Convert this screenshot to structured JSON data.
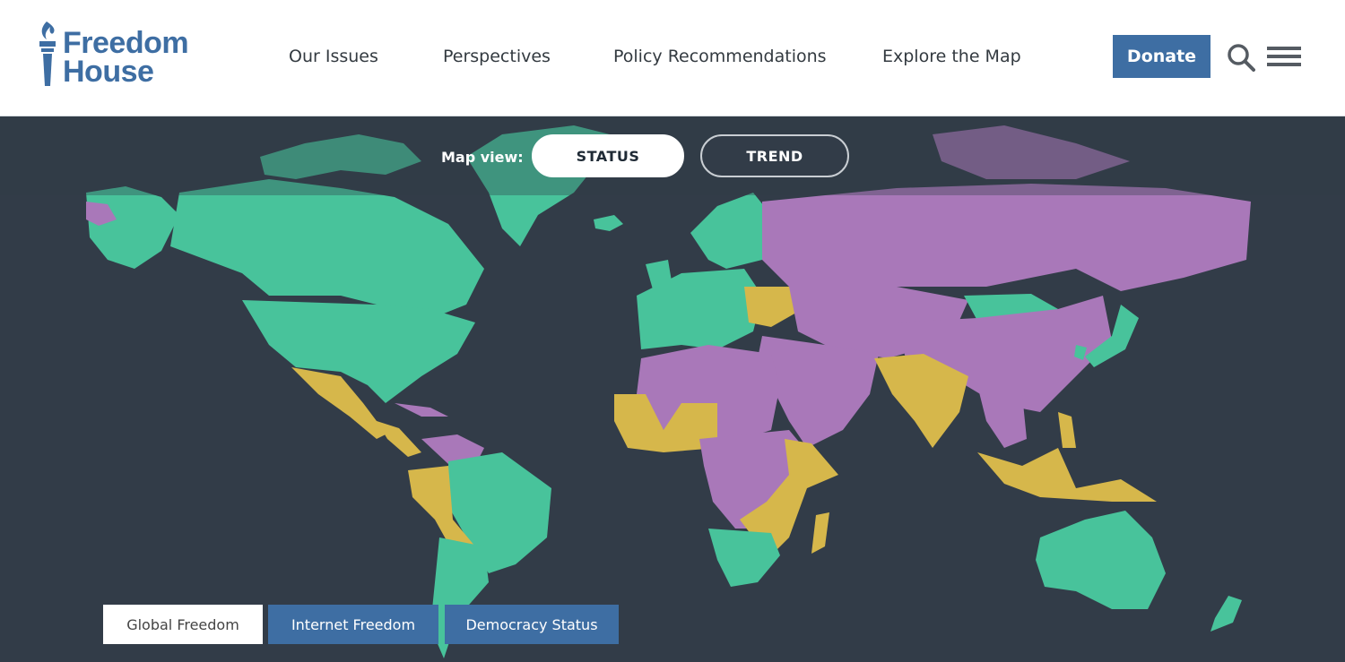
{
  "header": {
    "logo": {
      "line1": "Freedom",
      "line2": "House"
    },
    "nav": [
      "Our Issues",
      "Perspectives",
      "Policy Recommendations",
      "Explore the Map"
    ],
    "donate_label": "Donate"
  },
  "map": {
    "view_label": "Map view:",
    "toggles": {
      "status": "STATUS",
      "trend": "TREND"
    },
    "tabs": [
      "Global Freedom",
      "Internet Freedom",
      "Democracy Status"
    ],
    "colors": {
      "free": "#48c39b",
      "partly_free": "#d6b74b",
      "not_free": "#a978b9",
      "ocean": "#323c48",
      "brand": "#3e6ea3"
    }
  }
}
